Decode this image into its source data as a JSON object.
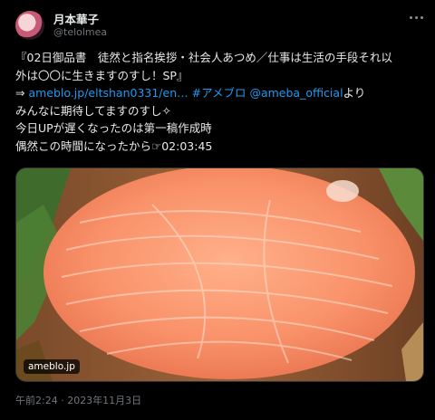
{
  "author": {
    "display_name": "月本華子",
    "handle": "@telolmea"
  },
  "tweet": {
    "line1": "『02日御品書　徒然と指名挨拶・社会人あつめ／仕事は生活の手段それ以",
    "line2": "外は〇〇に生きますのすし！SP』",
    "arrow": "⇒ ",
    "link_url": "ameblo.jp/eltshan0331/en…",
    "hashtag": "#アメブロ",
    "mention": "@ameba_official",
    "yori": "より",
    "line4": "みんなに期待してますのすし✧",
    "line5": "今日UPが遅くなったのは第一稿作成時",
    "line6": "偶然この時間になったから☞02:03:45"
  },
  "media": {
    "domain_label": "ameblo.jp"
  },
  "timestamp": "午前2:24 · 2023年11月3日"
}
